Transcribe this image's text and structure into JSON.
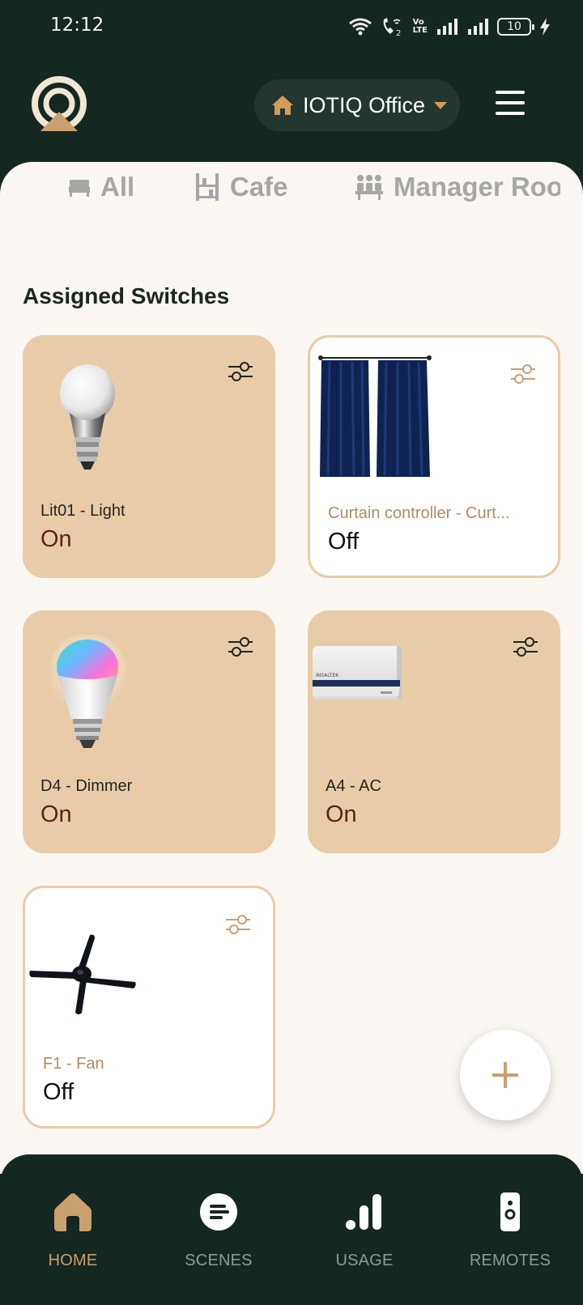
{
  "status_bar": {
    "time": "12:12",
    "battery": "10",
    "volte": "Vo\nLTE"
  },
  "header": {
    "home_name": "IOTIQ Office",
    "logo": "iotiq-logo",
    "menu_icon": "hamburger-menu-icon"
  },
  "tabs": [
    {
      "label": "All",
      "icon": "bed-icon"
    },
    {
      "label": "Cafe",
      "icon": "shelves-icon"
    },
    {
      "label": "Manager Roo",
      "icon": "meeting-icon"
    }
  ],
  "section_title": "Assigned Switches",
  "switches": [
    {
      "name": "Lit01 - Light",
      "state": "On",
      "image": "light-bulb-image"
    },
    {
      "name": "Curtain controller  - Curt...",
      "state": "Off",
      "image": "curtain-image"
    },
    {
      "name": "D4 - Dimmer",
      "state": "On",
      "image": "rgb-bulb-image"
    },
    {
      "name": "A4 - AC",
      "state": "On",
      "image": "air-conditioner-image"
    },
    {
      "name": "F1 - Fan",
      "state": "Off",
      "image": "ceiling-fan-image"
    }
  ],
  "fab": {
    "icon": "plus-icon"
  },
  "bottom_nav": [
    {
      "label": "HOME",
      "icon": "home-icon",
      "active": true
    },
    {
      "label": "SCENES",
      "icon": "scenes-icon",
      "active": false
    },
    {
      "label": "USAGE",
      "icon": "bar-chart-icon",
      "active": false
    },
    {
      "label": "REMOTES",
      "icon": "remote-icon",
      "active": false
    }
  ],
  "colors": {
    "background": "#152721",
    "panel": "#faf7f2",
    "card_on": "#e8cca7",
    "accent": "#c9a06e",
    "state_on": "#5b2416"
  }
}
